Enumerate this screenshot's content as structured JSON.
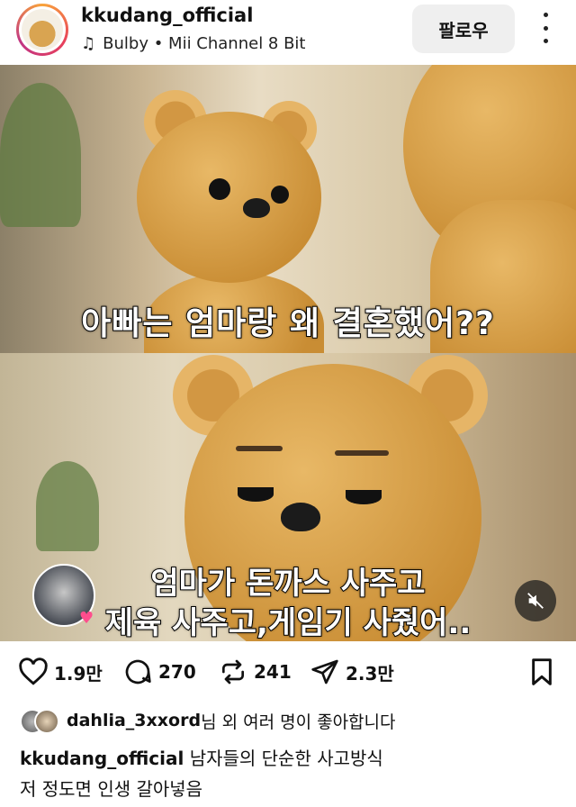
{
  "header": {
    "username": "kkudang_official",
    "music": "Bulby • Mii Channel 8 Bit",
    "follow_label": "팔로우"
  },
  "post": {
    "caption_top": "아빠는 엄마랑 왜 결혼했어??",
    "caption_bottom_line1": "엄마가 돈까스 사주고",
    "caption_bottom_line2": "제육 사주고,게임기 사줬어.."
  },
  "actions": {
    "likes_count": "1.9만",
    "comments_count": "270",
    "reposts_count": "241",
    "shares_count": "2.3만"
  },
  "likes_line": {
    "user": "dahlia_3xxord",
    "suffix": "님 외 여러 명이 좋아합니다"
  },
  "caption": {
    "author": "kkudang_official",
    "text_line1": "남자들의 단순한 사고방식",
    "text_line2": "저 정도면 인생 갈아넣음"
  },
  "icons": {
    "music": "music-note-icon",
    "more": "more-vertical-icon",
    "mute": "mute-icon",
    "like": "heart-outline-icon",
    "comment": "comment-bubble-icon",
    "repost": "repost-icon",
    "share": "send-icon",
    "save": "bookmark-icon"
  }
}
